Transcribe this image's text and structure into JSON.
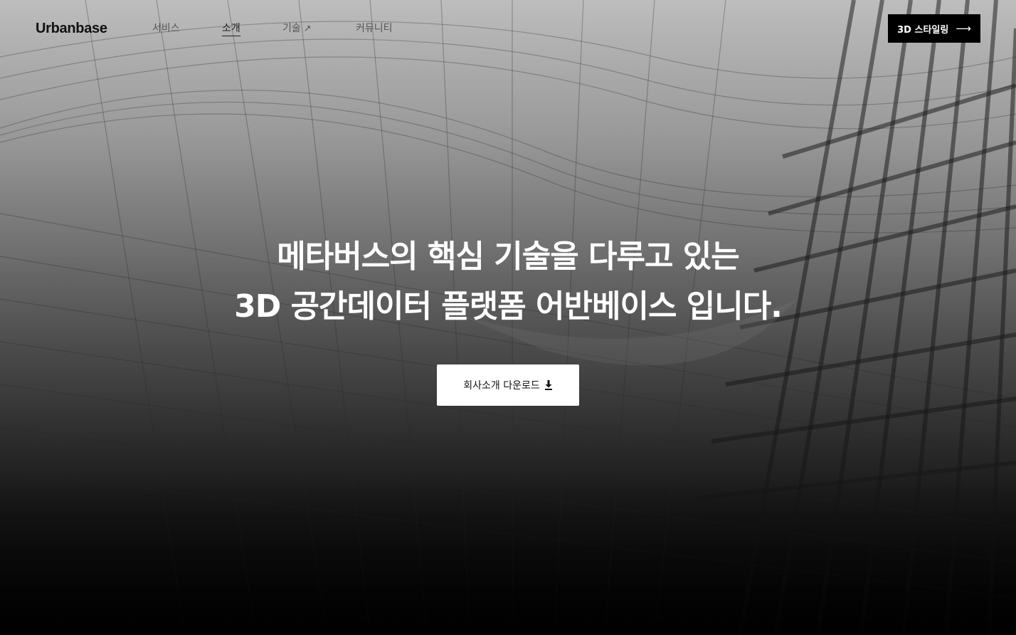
{
  "nav": {
    "logo": "Urbanbase",
    "items": [
      {
        "label": "서비스"
      },
      {
        "label": "소개",
        "active": true
      },
      {
        "label": "기술",
        "icon": "external-arrow-icon",
        "icon_glyph": "↗"
      },
      {
        "label": "커뮤니티"
      }
    ],
    "cta": {
      "label": "3D 스타일링",
      "icon": "arrow-right-icon",
      "icon_glyph": "⟶"
    }
  },
  "hero": {
    "headline_line1": "메타버스의 핵심 기술을 다루고 있는",
    "headline_line2": "3D 공간데이터 플랫폼 어반베이스 입니다.",
    "download_button": {
      "label": "회사소개 다운로드",
      "icon": "download-icon"
    }
  },
  "colors": {
    "cta_background": "#000000",
    "cta_text": "#ffffff",
    "headline_text": "#ffffff",
    "download_background": "#ffffff"
  }
}
